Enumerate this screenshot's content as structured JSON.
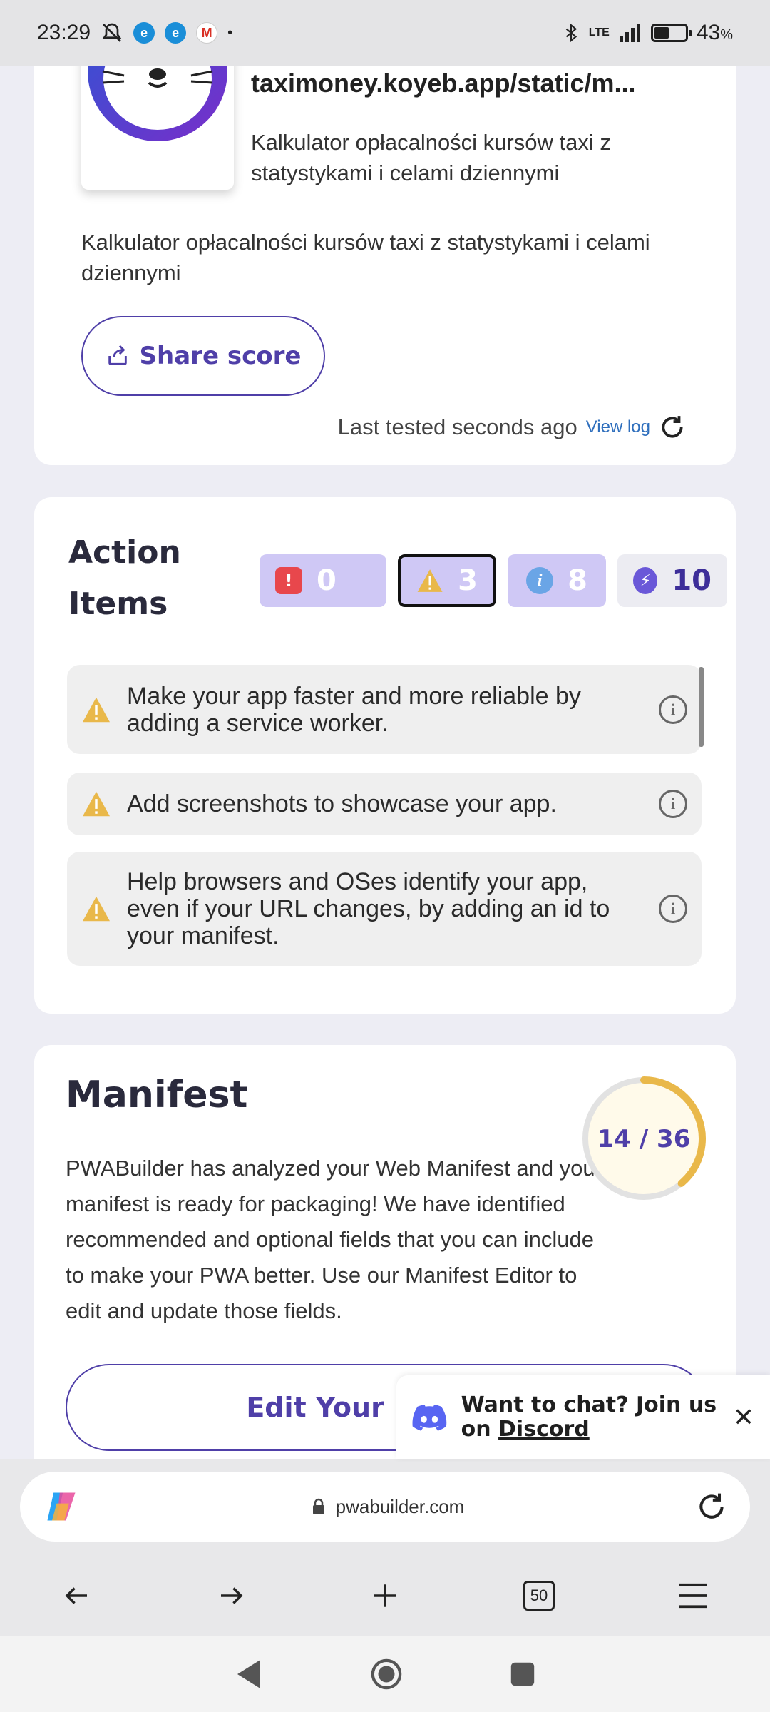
{
  "status_bar": {
    "time": "23:29",
    "network": "LTE",
    "battery": "43",
    "battery_unit": "%",
    "battery_level": 0.43
  },
  "app_card": {
    "url": "taximoney.koyeb.app/static/m...",
    "short_description": "Kalkulator opłacalności kursów taxi z statystykami i celami dziennymi",
    "description": "Kalkulator opłacalności kursów taxi z statystykami i celami dziennymi",
    "share_label": "Share score",
    "last_tested": "Last tested seconds ago",
    "view_log": "View log"
  },
  "action_items": {
    "title": "Action Items",
    "badges": [
      {
        "name": "errors",
        "count": "0",
        "color": "#e8474c"
      },
      {
        "name": "warnings",
        "count": "3",
        "color": "#e9b84a"
      },
      {
        "name": "info",
        "count": "8",
        "color": "#6aa5e6"
      },
      {
        "name": "performance",
        "count": "10",
        "color": "#6a58d8"
      }
    ],
    "items": [
      {
        "text": "Make your app faster and more reliable by adding a service worker."
      },
      {
        "text": "Add screenshots to showcase your app."
      },
      {
        "text": "Help browsers and OSes identify your app, even if your URL changes, by adding an id to your manifest."
      }
    ]
  },
  "manifest": {
    "title": "Manifest",
    "description": "PWABuilder has analyzed your Web Manifest and your manifest is ready for packaging! We have identified recommended and optional fields that you can include to make your PWA better. Use our Manifest Editor to edit and update those fields.",
    "score": "14 / 36",
    "score_fraction": 0.389,
    "edit_label": "Edit Your Manifest"
  },
  "discord_toast": {
    "text": "Want to chat? Join us on",
    "link": "Discord"
  },
  "browser": {
    "url": "pwabuilder.com",
    "tab_count": "50"
  },
  "colors": {
    "accent": "#4f3fa8",
    "warning": "#e9b84a",
    "badge_bg": "#cfc8f5"
  }
}
